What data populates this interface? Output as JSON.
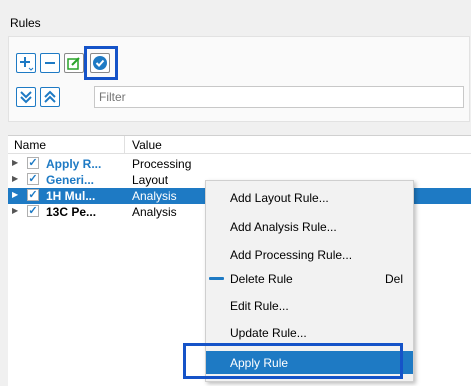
{
  "panel": {
    "title": "Rules"
  },
  "toolbar": {
    "add_icon": "plus-dropdown-icon",
    "remove_icon": "minus-icon",
    "edit_icon": "edit-icon",
    "apply_icon": "check-circle-icon",
    "expand_icon": "expand-all-icon",
    "collapse_icon": "collapse-all-icon",
    "filter_placeholder": "Filter"
  },
  "tree": {
    "columns": [
      "Name",
      "Value"
    ],
    "rows": [
      {
        "name": "Apply R...",
        "value": "Processing",
        "checked": true,
        "selected": false,
        "name_color": "#1e7ac4"
      },
      {
        "name": "Generi...",
        "value": "Layout",
        "checked": true,
        "selected": false,
        "name_color": "#1e7ac4"
      },
      {
        "name": "1H Mul...",
        "value": "Analysis",
        "checked": true,
        "selected": true,
        "name_color": "#ffffff"
      },
      {
        "name": "13C Pe...",
        "value": "Analysis",
        "checked": true,
        "selected": false,
        "name_color": "#000000"
      }
    ]
  },
  "context_menu": {
    "items": [
      {
        "label": "Add Layout Rule..."
      },
      {
        "label": "Add Analysis Rule..."
      },
      {
        "label": "Add Processing Rule..."
      },
      {
        "label": "Delete Rule",
        "shortcut": "Del"
      },
      {
        "label": "Edit Rule..."
      },
      {
        "label": "Update Rule..."
      },
      {
        "label": "Apply Rule"
      }
    ]
  },
  "colors": {
    "accent": "#1e7ac4",
    "selection": "#1e7ac4",
    "highlight_box": "#1553c8",
    "menu_hover": "#1e7ac4"
  }
}
